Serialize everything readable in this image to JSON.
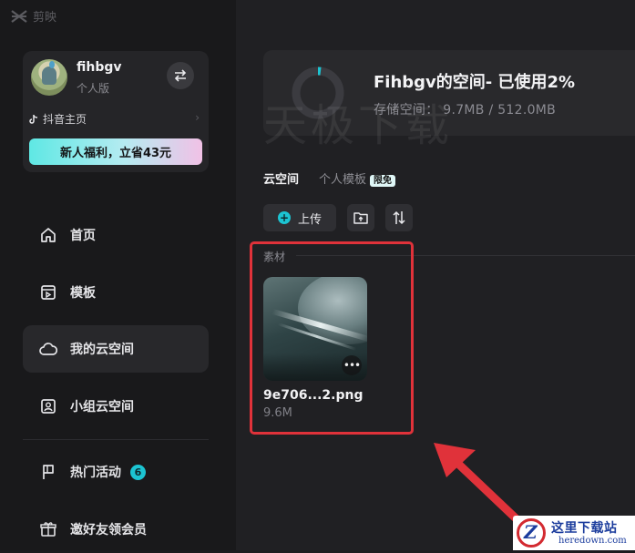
{
  "app": {
    "name": "剪映"
  },
  "profile": {
    "username": "fihbgv",
    "tier": "个人版",
    "douyin_link": "抖音主页",
    "promo": "新人福利，立省43元"
  },
  "nav": [
    {
      "label": "首页",
      "icon": "home-icon"
    },
    {
      "label": "模板",
      "icon": "template-icon"
    },
    {
      "label": "我的云空间",
      "icon": "cloud-icon"
    },
    {
      "label": "小组云空间",
      "icon": "group-space-icon"
    },
    {
      "label": "热门活动",
      "icon": "flag-icon",
      "badge": "6"
    },
    {
      "label": "邀好友领会员",
      "icon": "gift-icon"
    }
  ],
  "storage": {
    "title": "Fihbgv的空间- 已使用2%",
    "usage": "存储空间： 9.7MB / 512.0MB",
    "used_fraction": 0.02,
    "watermark": "天极下载"
  },
  "tabs": [
    {
      "label": "云空间",
      "active": true
    },
    {
      "label": "个人模板",
      "tag": "限免"
    }
  ],
  "toolbar": {
    "upload": "上传"
  },
  "section": {
    "label": "素材"
  },
  "files": [
    {
      "name": "9e706...2.png",
      "size": "9.6M"
    }
  ],
  "site_logo": {
    "cn": "这里下载站",
    "en": "heredown.com",
    "mark": "Z"
  },
  "colors": {
    "accent": "#1cc4d2",
    "highlight": "#e0323a",
    "sidebar_bg": "#19191b",
    "main_bg": "#202023"
  }
}
